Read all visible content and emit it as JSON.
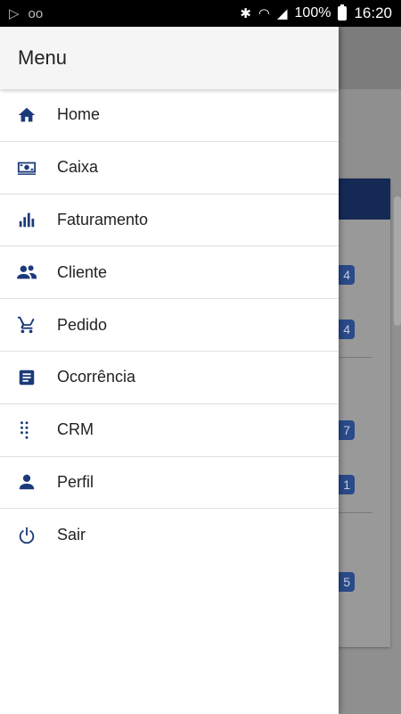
{
  "status_bar": {
    "battery": "100%",
    "time": "16:20"
  },
  "drawer": {
    "title": "Menu",
    "items": [
      {
        "label": "Home",
        "icon": "home-icon"
      },
      {
        "label": "Caixa",
        "icon": "cash-icon"
      },
      {
        "label": "Faturamento",
        "icon": "bar-chart-icon"
      },
      {
        "label": "Cliente",
        "icon": "people-icon"
      },
      {
        "label": "Pedido",
        "icon": "cart-icon"
      },
      {
        "label": "Ocorrência",
        "icon": "document-icon"
      },
      {
        "label": "CRM",
        "icon": "dialpad-icon"
      },
      {
        "label": "Perfil",
        "icon": "person-icon"
      },
      {
        "label": "Sair",
        "icon": "power-icon"
      }
    ]
  },
  "background": {
    "badges": [
      "4",
      "4",
      "7",
      "1",
      "5"
    ]
  },
  "colors": {
    "accent": "#1b3a7a",
    "header_dark": "#142a55"
  }
}
